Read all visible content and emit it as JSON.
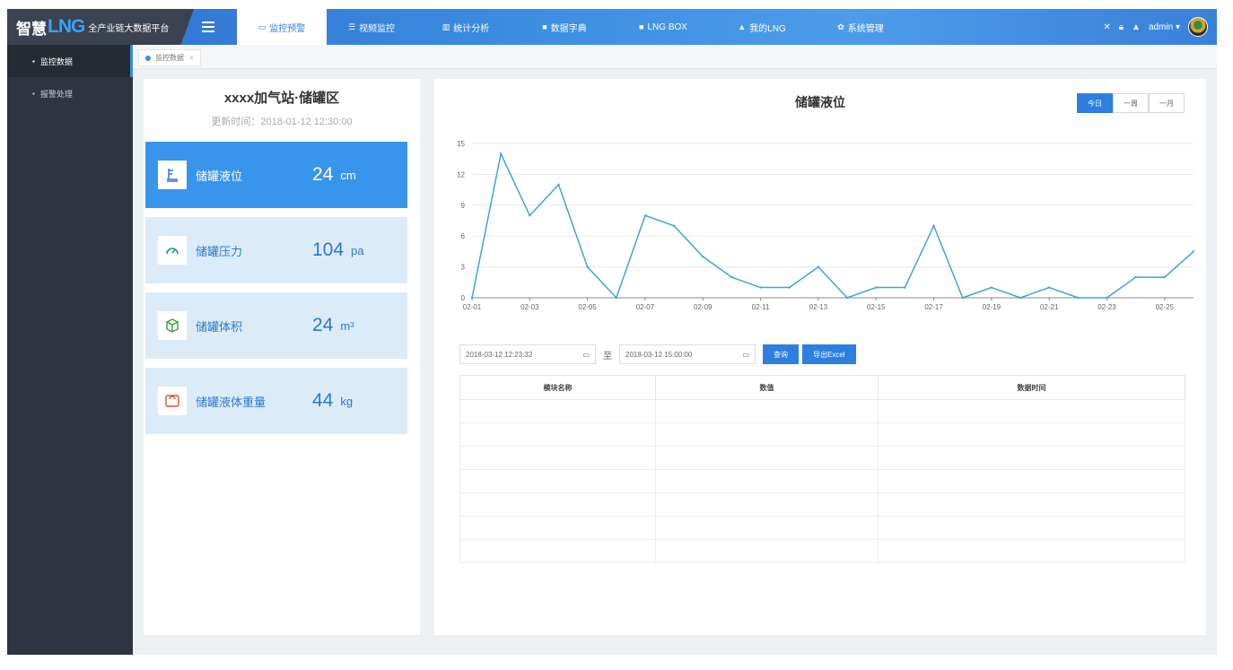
{
  "header": {
    "brand_prefix": "智慧",
    "brand_lng": "LNG",
    "brand_suffix": "全产业链大数据平台",
    "nav": [
      {
        "label": "监控预警",
        "icon": "monitor-icon",
        "active": true
      },
      {
        "label": "视频监控",
        "icon": "list-icon",
        "active": false
      },
      {
        "label": "统计分析",
        "icon": "bar-chart-icon",
        "active": false
      },
      {
        "label": "数据字典",
        "icon": "book-icon",
        "active": false
      },
      {
        "label": "LNG BOX",
        "icon": "box-icon",
        "active": false
      },
      {
        "label": "我的LNG",
        "icon": "user-icon",
        "active": false
      },
      {
        "label": "系统管理",
        "icon": "gear-icon",
        "active": false
      }
    ],
    "user": "admin"
  },
  "sidebar": {
    "items": [
      {
        "label": "监控数据",
        "active": true
      },
      {
        "label": "报警处理",
        "active": false
      }
    ]
  },
  "tabs": [
    {
      "label": "监控数据"
    }
  ],
  "station": {
    "title": "xxxx加气站·储罐区",
    "updated": "更新时间：2018-01-12 12:30:00"
  },
  "metrics": [
    {
      "label": "储罐液位",
      "value": "24",
      "unit": "cm",
      "icon": "liquid-level-icon",
      "active": true
    },
    {
      "label": "储罐压力",
      "value": "104",
      "unit": "pa",
      "icon": "gauge-icon",
      "active": false
    },
    {
      "label": "储罐体积",
      "value": "24",
      "unit": "m³",
      "icon": "cube-icon",
      "active": false
    },
    {
      "label": "储罐液体重量",
      "value": "44",
      "unit": "kg",
      "icon": "scale-icon",
      "active": false
    }
  ],
  "range": {
    "today": "今日",
    "week": "一周",
    "month": "一月"
  },
  "filter": {
    "start": "2018-03-12 12:23:32",
    "to": "至",
    "end": "2018-03-12 15:00:00",
    "query": "查询",
    "export": "导出Excel"
  },
  "table": {
    "headers": [
      "模块名称",
      "数值",
      "数据时间"
    ],
    "rows": 7
  },
  "colors": {
    "accent": "#2d7fe0",
    "line": "#3ba5e0",
    "sidebar": "#2f3540",
    "card": "#dcebf8",
    "card_active": "#3995ec"
  },
  "chart_data": {
    "type": "line",
    "title": "储罐液位",
    "x": [
      "02-01",
      "02-02",
      "02-03",
      "02-04",
      "02-05",
      "02-06",
      "02-07",
      "02-08",
      "02-09",
      "02-10",
      "02-11",
      "02-12",
      "02-13",
      "02-14",
      "02-15",
      "02-16",
      "02-17",
      "02-18",
      "02-19",
      "02-20",
      "02-21",
      "02-22",
      "02-23",
      "02-24",
      "02-25",
      "02-26"
    ],
    "x_tick_labels": [
      "02-01",
      "02-03",
      "02-05",
      "02-07",
      "02-09",
      "02-11",
      "02-13",
      "02-15",
      "02-17",
      "02-19",
      "02-21",
      "02-23",
      "02-25"
    ],
    "series": [
      {
        "values": [
          0,
          14,
          8,
          11,
          3,
          0,
          8,
          7,
          4,
          2,
          1,
          1,
          3,
          0,
          1,
          1,
          7,
          0,
          1,
          0,
          1,
          0,
          0,
          2,
          2,
          4.5
        ]
      }
    ],
    "ylim": [
      0,
      15
    ],
    "y_ticks": [
      0,
      3,
      6,
      9,
      12,
      15
    ],
    "xlabel": "",
    "ylabel": "",
    "grid": true,
    "legend": "none"
  }
}
